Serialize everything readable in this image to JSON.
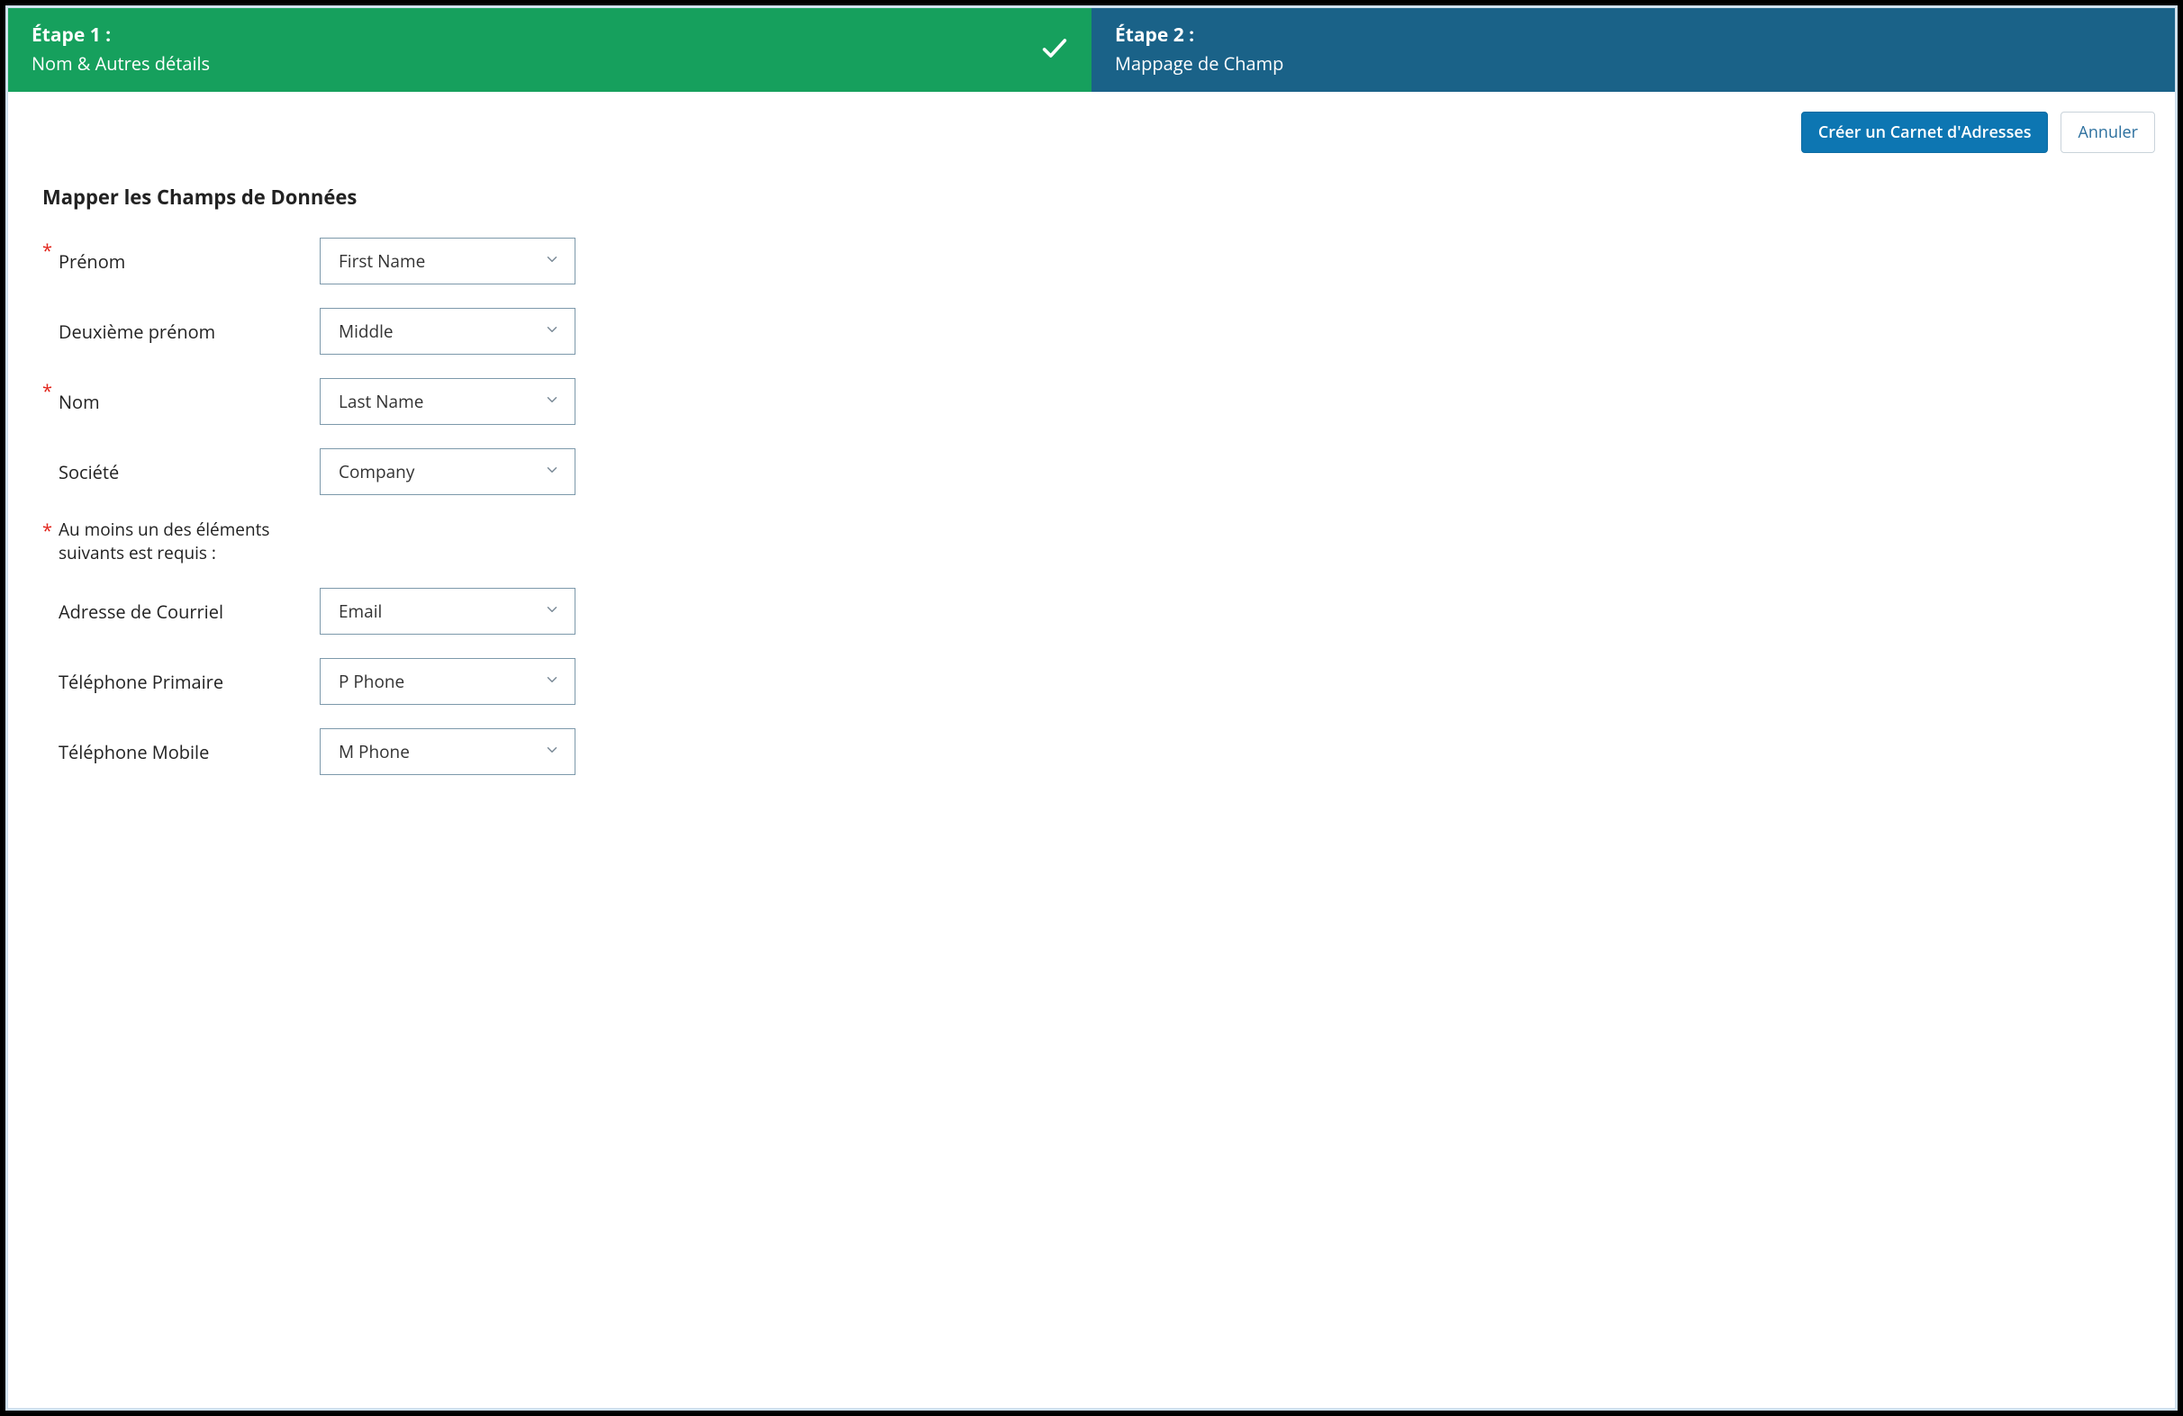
{
  "steps": {
    "one": {
      "title": "Étape 1 :",
      "subtitle": "Nom & Autres détails"
    },
    "two": {
      "title": "Étape 2 :",
      "subtitle": "Mappage de Champ"
    }
  },
  "actions": {
    "create": "Créer un Carnet d'Adresses",
    "cancel": "Annuler"
  },
  "section_title": "Mapper les Champs de Données",
  "fields": {
    "first_name": {
      "label": "Prénom",
      "value": "First Name",
      "required": true
    },
    "middle_name": {
      "label": "Deuxième prénom",
      "value": "Middle",
      "required": false
    },
    "last_name": {
      "label": "Nom",
      "value": "Last Name",
      "required": true
    },
    "company": {
      "label": "Société",
      "value": "Company",
      "required": false
    },
    "note": {
      "label": "Au moins un des éléments suivants est requis :",
      "required": true
    },
    "email": {
      "label": "Adresse de Courriel",
      "value": "Email",
      "required": false
    },
    "primary_phone": {
      "label": "Téléphone Primaire",
      "value": "P Phone",
      "required": false
    },
    "mobile_phone": {
      "label": "Téléphone Mobile",
      "value": "M Phone",
      "required": false
    }
  },
  "asterisk": "*"
}
